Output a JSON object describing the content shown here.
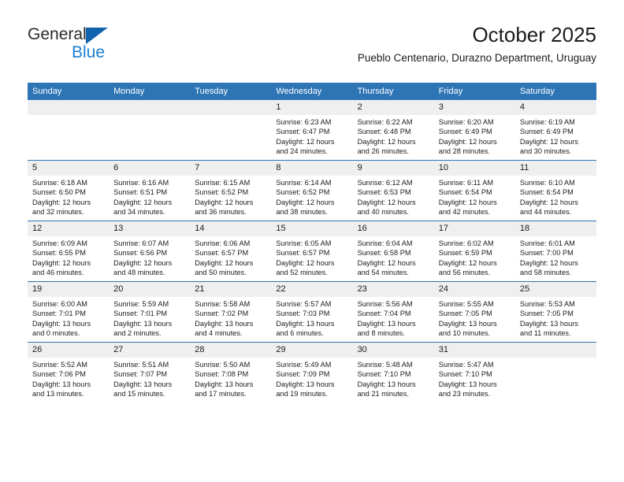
{
  "brand": {
    "name_part1": "General",
    "name_part2": "Blue",
    "triangle_color": "#1163ad",
    "blue_text_color": "#1a7fd4"
  },
  "header": {
    "title": "October 2025",
    "subtitle": "Pueblo Centenario, Durazno Department, Uruguay"
  },
  "theme": {
    "header_bg": "#2e75b6",
    "daynum_bg": "#efefef",
    "row_border": "#2e75b6"
  },
  "weekday_headers": [
    "Sunday",
    "Monday",
    "Tuesday",
    "Wednesday",
    "Thursday",
    "Friday",
    "Saturday"
  ],
  "weeks": [
    [
      {
        "day": "",
        "sunrise": "",
        "sunset": "",
        "daylight1": "",
        "daylight2": ""
      },
      {
        "day": "",
        "sunrise": "",
        "sunset": "",
        "daylight1": "",
        "daylight2": ""
      },
      {
        "day": "",
        "sunrise": "",
        "sunset": "",
        "daylight1": "",
        "daylight2": ""
      },
      {
        "day": "1",
        "sunrise": "Sunrise: 6:23 AM",
        "sunset": "Sunset: 6:47 PM",
        "daylight1": "Daylight: 12 hours",
        "daylight2": "and 24 minutes."
      },
      {
        "day": "2",
        "sunrise": "Sunrise: 6:22 AM",
        "sunset": "Sunset: 6:48 PM",
        "daylight1": "Daylight: 12 hours",
        "daylight2": "and 26 minutes."
      },
      {
        "day": "3",
        "sunrise": "Sunrise: 6:20 AM",
        "sunset": "Sunset: 6:49 PM",
        "daylight1": "Daylight: 12 hours",
        "daylight2": "and 28 minutes."
      },
      {
        "day": "4",
        "sunrise": "Sunrise: 6:19 AM",
        "sunset": "Sunset: 6:49 PM",
        "daylight1": "Daylight: 12 hours",
        "daylight2": "and 30 minutes."
      }
    ],
    [
      {
        "day": "5",
        "sunrise": "Sunrise: 6:18 AM",
        "sunset": "Sunset: 6:50 PM",
        "daylight1": "Daylight: 12 hours",
        "daylight2": "and 32 minutes."
      },
      {
        "day": "6",
        "sunrise": "Sunrise: 6:16 AM",
        "sunset": "Sunset: 6:51 PM",
        "daylight1": "Daylight: 12 hours",
        "daylight2": "and 34 minutes."
      },
      {
        "day": "7",
        "sunrise": "Sunrise: 6:15 AM",
        "sunset": "Sunset: 6:52 PM",
        "daylight1": "Daylight: 12 hours",
        "daylight2": "and 36 minutes."
      },
      {
        "day": "8",
        "sunrise": "Sunrise: 6:14 AM",
        "sunset": "Sunset: 6:52 PM",
        "daylight1": "Daylight: 12 hours",
        "daylight2": "and 38 minutes."
      },
      {
        "day": "9",
        "sunrise": "Sunrise: 6:12 AM",
        "sunset": "Sunset: 6:53 PM",
        "daylight1": "Daylight: 12 hours",
        "daylight2": "and 40 minutes."
      },
      {
        "day": "10",
        "sunrise": "Sunrise: 6:11 AM",
        "sunset": "Sunset: 6:54 PM",
        "daylight1": "Daylight: 12 hours",
        "daylight2": "and 42 minutes."
      },
      {
        "day": "11",
        "sunrise": "Sunrise: 6:10 AM",
        "sunset": "Sunset: 6:54 PM",
        "daylight1": "Daylight: 12 hours",
        "daylight2": "and 44 minutes."
      }
    ],
    [
      {
        "day": "12",
        "sunrise": "Sunrise: 6:09 AM",
        "sunset": "Sunset: 6:55 PM",
        "daylight1": "Daylight: 12 hours",
        "daylight2": "and 46 minutes."
      },
      {
        "day": "13",
        "sunrise": "Sunrise: 6:07 AM",
        "sunset": "Sunset: 6:56 PM",
        "daylight1": "Daylight: 12 hours",
        "daylight2": "and 48 minutes."
      },
      {
        "day": "14",
        "sunrise": "Sunrise: 6:06 AM",
        "sunset": "Sunset: 6:57 PM",
        "daylight1": "Daylight: 12 hours",
        "daylight2": "and 50 minutes."
      },
      {
        "day": "15",
        "sunrise": "Sunrise: 6:05 AM",
        "sunset": "Sunset: 6:57 PM",
        "daylight1": "Daylight: 12 hours",
        "daylight2": "and 52 minutes."
      },
      {
        "day": "16",
        "sunrise": "Sunrise: 6:04 AM",
        "sunset": "Sunset: 6:58 PM",
        "daylight1": "Daylight: 12 hours",
        "daylight2": "and 54 minutes."
      },
      {
        "day": "17",
        "sunrise": "Sunrise: 6:02 AM",
        "sunset": "Sunset: 6:59 PM",
        "daylight1": "Daylight: 12 hours",
        "daylight2": "and 56 minutes."
      },
      {
        "day": "18",
        "sunrise": "Sunrise: 6:01 AM",
        "sunset": "Sunset: 7:00 PM",
        "daylight1": "Daylight: 12 hours",
        "daylight2": "and 58 minutes."
      }
    ],
    [
      {
        "day": "19",
        "sunrise": "Sunrise: 6:00 AM",
        "sunset": "Sunset: 7:01 PM",
        "daylight1": "Daylight: 13 hours",
        "daylight2": "and 0 minutes."
      },
      {
        "day": "20",
        "sunrise": "Sunrise: 5:59 AM",
        "sunset": "Sunset: 7:01 PM",
        "daylight1": "Daylight: 13 hours",
        "daylight2": "and 2 minutes."
      },
      {
        "day": "21",
        "sunrise": "Sunrise: 5:58 AM",
        "sunset": "Sunset: 7:02 PM",
        "daylight1": "Daylight: 13 hours",
        "daylight2": "and 4 minutes."
      },
      {
        "day": "22",
        "sunrise": "Sunrise: 5:57 AM",
        "sunset": "Sunset: 7:03 PM",
        "daylight1": "Daylight: 13 hours",
        "daylight2": "and 6 minutes."
      },
      {
        "day": "23",
        "sunrise": "Sunrise: 5:56 AM",
        "sunset": "Sunset: 7:04 PM",
        "daylight1": "Daylight: 13 hours",
        "daylight2": "and 8 minutes."
      },
      {
        "day": "24",
        "sunrise": "Sunrise: 5:55 AM",
        "sunset": "Sunset: 7:05 PM",
        "daylight1": "Daylight: 13 hours",
        "daylight2": "and 10 minutes."
      },
      {
        "day": "25",
        "sunrise": "Sunrise: 5:53 AM",
        "sunset": "Sunset: 7:05 PM",
        "daylight1": "Daylight: 13 hours",
        "daylight2": "and 11 minutes."
      }
    ],
    [
      {
        "day": "26",
        "sunrise": "Sunrise: 5:52 AM",
        "sunset": "Sunset: 7:06 PM",
        "daylight1": "Daylight: 13 hours",
        "daylight2": "and 13 minutes."
      },
      {
        "day": "27",
        "sunrise": "Sunrise: 5:51 AM",
        "sunset": "Sunset: 7:07 PM",
        "daylight1": "Daylight: 13 hours",
        "daylight2": "and 15 minutes."
      },
      {
        "day": "28",
        "sunrise": "Sunrise: 5:50 AM",
        "sunset": "Sunset: 7:08 PM",
        "daylight1": "Daylight: 13 hours",
        "daylight2": "and 17 minutes."
      },
      {
        "day": "29",
        "sunrise": "Sunrise: 5:49 AM",
        "sunset": "Sunset: 7:09 PM",
        "daylight1": "Daylight: 13 hours",
        "daylight2": "and 19 minutes."
      },
      {
        "day": "30",
        "sunrise": "Sunrise: 5:48 AM",
        "sunset": "Sunset: 7:10 PM",
        "daylight1": "Daylight: 13 hours",
        "daylight2": "and 21 minutes."
      },
      {
        "day": "31",
        "sunrise": "Sunrise: 5:47 AM",
        "sunset": "Sunset: 7:10 PM",
        "daylight1": "Daylight: 13 hours",
        "daylight2": "and 23 minutes."
      },
      {
        "day": "",
        "sunrise": "",
        "sunset": "",
        "daylight1": "",
        "daylight2": ""
      }
    ]
  ]
}
